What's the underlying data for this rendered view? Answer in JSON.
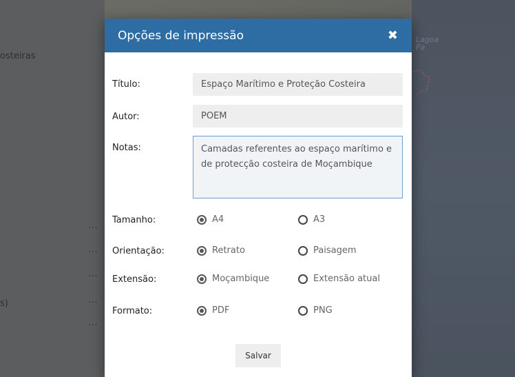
{
  "background": {
    "left_texts": [
      "osteiras",
      "s)"
    ],
    "map_label": "Lagoa Pa",
    "dots": "..."
  },
  "modal": {
    "title": "Opções de impressão",
    "close": "✖",
    "fields": {
      "title_label": "Título:",
      "title_value": "Espaço Marítimo e Proteção Costeira",
      "author_label": "Autor:",
      "author_value": "POEM",
      "notes_label": "Notas:",
      "notes_value": "Camadas referentes ao espaço marítimo e de protecção costeira de Moçambique"
    },
    "options": {
      "size_label": "Tamanho:",
      "size_a": "A4",
      "size_b": "A3",
      "orientation_label": "Orientação:",
      "orientation_a": "Retrato",
      "orientation_b": "Paisagem",
      "extent_label": "Extensão:",
      "extent_a": "Moçambique",
      "extent_b": "Extensão atual",
      "format_label": "Formato:",
      "format_a": "PDF",
      "format_b": "PNG"
    },
    "save_label": "Salvar"
  }
}
